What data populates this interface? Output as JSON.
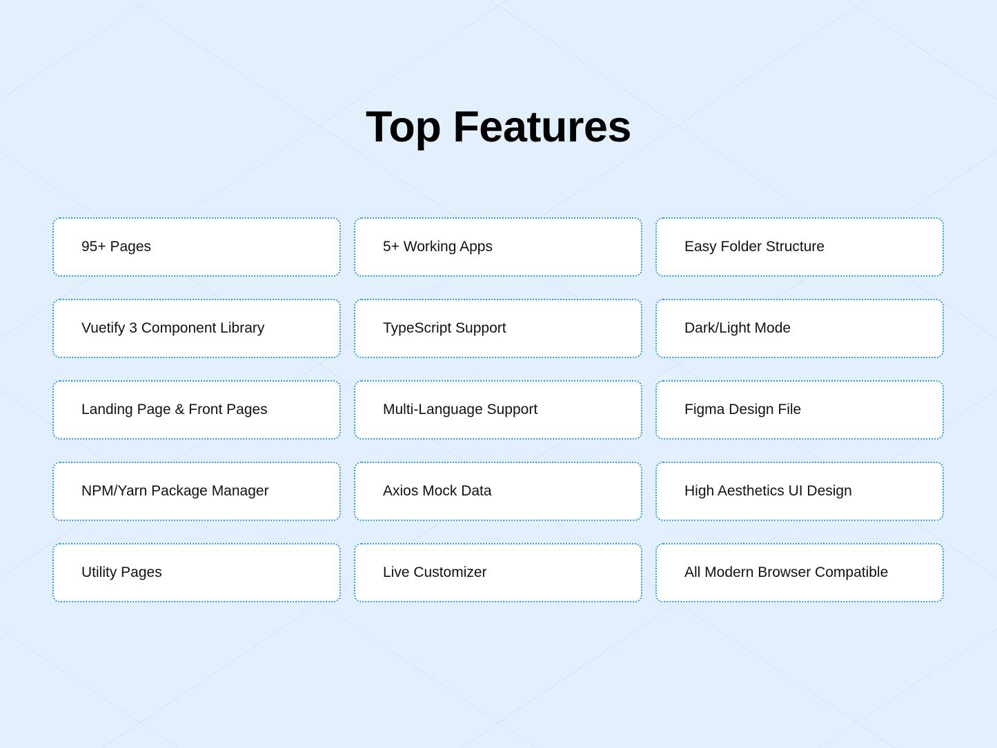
{
  "page": {
    "background_color": "#e2effc",
    "card_background": "#ffffff",
    "card_border_color": "#2196f3",
    "title_color": "#000000"
  },
  "header": {
    "title": "Top Features"
  },
  "features": {
    "items": [
      {
        "label": "95+ Pages"
      },
      {
        "label": "5+ Working Apps"
      },
      {
        "label": "Easy Folder Structure"
      },
      {
        "label": "Vuetify 3 Component Library"
      },
      {
        "label": "TypeScript Support"
      },
      {
        "label": "Dark/Light Mode"
      },
      {
        "label": "Landing Page & Front Pages"
      },
      {
        "label": "Multi-Language Support"
      },
      {
        "label": "Figma Design File"
      },
      {
        "label": "NPM/Yarn Package Manager"
      },
      {
        "label": "Axios Mock Data"
      },
      {
        "label": "High Aesthetics UI Design"
      },
      {
        "label": "Utility Pages"
      },
      {
        "label": "Live Customizer"
      },
      {
        "label": "All Modern Browser Compatible"
      }
    ]
  }
}
